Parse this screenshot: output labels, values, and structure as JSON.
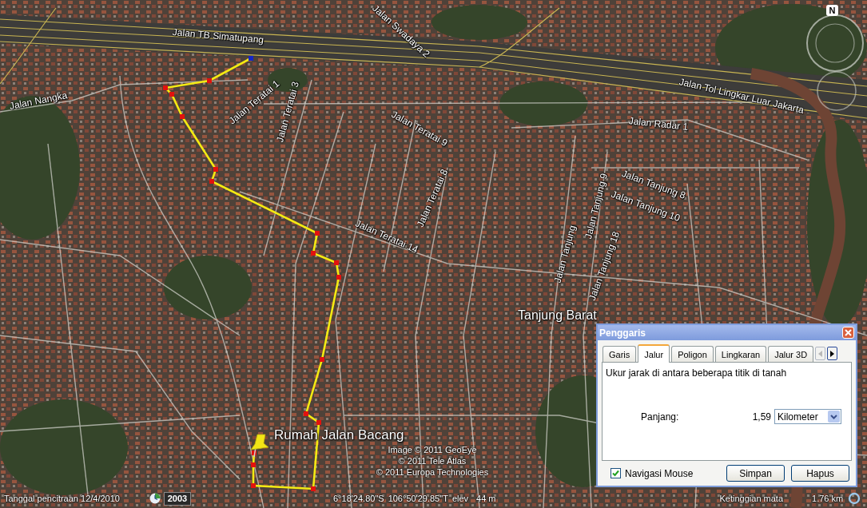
{
  "map": {
    "road_labels": [
      "Jalan Swadaya 2",
      "Jalan TB Simatupang",
      "Jalan Tol Lingkar Luar Jakarta",
      "Jalan Nangka",
      "Jalan Teratai 1",
      "Jalan Teratai 3",
      "Jalan Radar 1",
      "Jalan Teratai 9",
      "Jalan Tanjung 8",
      "Jalan Tanjung 9",
      "Jalan Tanjung 10",
      "Jalan Teratai 8",
      "Jalan Teratai 14",
      "Jalan Tanjung",
      "Jalan Tanjung 18"
    ],
    "place_label": "Tanjung Barat",
    "placemark": {
      "label": "Rumah Jalan Bacang"
    },
    "attribution": [
      "Image © 2011 GeoEye",
      "© 2011 Tele Atlas",
      "© 2011 Europa Technologies"
    ],
    "compass": {
      "north": "N"
    }
  },
  "status_bar": {
    "imagery_date": "Tanggal pencitraan 12/4/2010",
    "historical_year": "2003",
    "latitude": "6°18'24.80\"S",
    "longitude": "106°50'29.85\"T",
    "elevation_label": "elev",
    "elevation": "44 m",
    "eye_altitude_label": "Ketinggian mata",
    "eye_altitude": "1.76 km"
  },
  "ruler_dialog": {
    "title": "Penggaris",
    "tabs": [
      {
        "label": "Garis",
        "selected": false
      },
      {
        "label": "Jalur",
        "selected": true
      },
      {
        "label": "Poligon",
        "selected": false
      },
      {
        "label": "Lingkaran",
        "selected": false
      },
      {
        "label": "Jalur 3D",
        "selected": false
      }
    ],
    "description": "Ukur jarak di antara beberapa titik di tanah",
    "length_label": "Panjang:",
    "length_value": "1,59",
    "unit": "Kilometer",
    "mouse_navigation": {
      "label": "Navigasi Mouse",
      "checked": true
    },
    "buttons": [
      "Simpan",
      "Hapus"
    ]
  }
}
